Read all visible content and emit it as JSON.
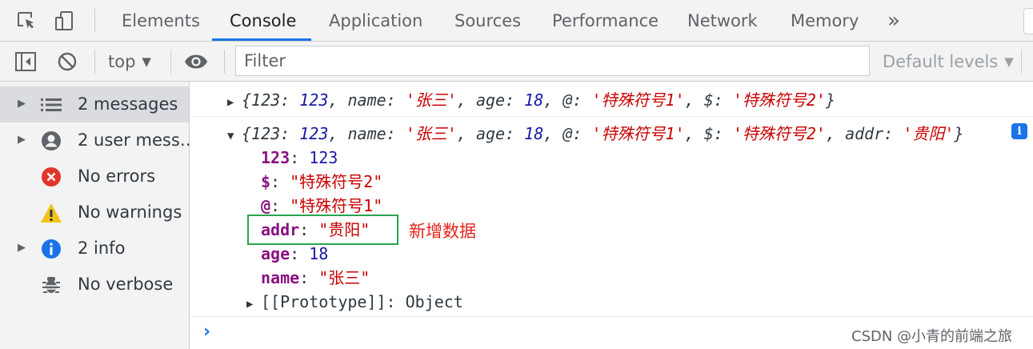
{
  "tabs": {
    "items": [
      "Elements",
      "Console",
      "Application",
      "Sources",
      "Performance",
      "Network",
      "Memory"
    ],
    "active": "Console",
    "more_label": "»"
  },
  "toolbar": {
    "context": "top",
    "filter_placeholder": "Filter",
    "levels": "Default levels"
  },
  "sidebar": {
    "items": [
      {
        "label": "2 messages",
        "icon": "list-icon",
        "expandable": true,
        "selected": true
      },
      {
        "label": "2 user mess…",
        "icon": "user-icon",
        "expandable": true,
        "selected": false
      },
      {
        "label": "No errors",
        "icon": "error-icon",
        "expandable": false,
        "selected": false
      },
      {
        "label": "No warnings",
        "icon": "warning-icon",
        "expandable": false,
        "selected": false
      },
      {
        "label": "2 info",
        "icon": "info-icon",
        "expandable": true,
        "selected": false
      },
      {
        "label": "No verbose",
        "icon": "bug-icon",
        "expandable": false,
        "selected": false
      }
    ]
  },
  "console": {
    "log1": {
      "open": "{",
      "k1": "123",
      "v1": "123",
      "k2": "name",
      "v2": "'张三'",
      "k3": "age",
      "v3": "18",
      "k4": "@",
      "v4": "'特殊符号1'",
      "k5": "$",
      "v5": "'特殊符号2'",
      "close": "}"
    },
    "log2": {
      "open": "{",
      "k1": "123",
      "v1": "123",
      "k2": "name",
      "v2": "'张三'",
      "k3": "age",
      "v3": "18",
      "k4": "@",
      "v4": "'特殊符号1'",
      "k5": "$",
      "v5": "'特殊符号2'",
      "k6": "addr",
      "v6": "'贵阳'",
      "close": "}",
      "info_badge": "i",
      "props": [
        {
          "key": "123",
          "value": "123",
          "type": "number"
        },
        {
          "key": "$",
          "value": "\"特殊符号2\"",
          "type": "string"
        },
        {
          "key": "@",
          "value": "\"特殊符号1\"",
          "type": "string"
        },
        {
          "key": "addr",
          "value": "\"贵阳\"",
          "type": "string"
        },
        {
          "key": "age",
          "value": "18",
          "type": "number"
        },
        {
          "key": "name",
          "value": "\"张三\"",
          "type": "string"
        }
      ],
      "prototype_key": "[[Prototype]]",
      "prototype_value": "Object"
    },
    "annotation": "新增数据",
    "prompt": "›"
  },
  "watermark": "CSDN @小青的前端之旅",
  "colors": {
    "accent": "#1a73e8",
    "key": "#881280",
    "number": "#1a1aa6",
    "string": "#c80000",
    "highlight": "#2aa44f",
    "annotation": "#e3241b"
  }
}
